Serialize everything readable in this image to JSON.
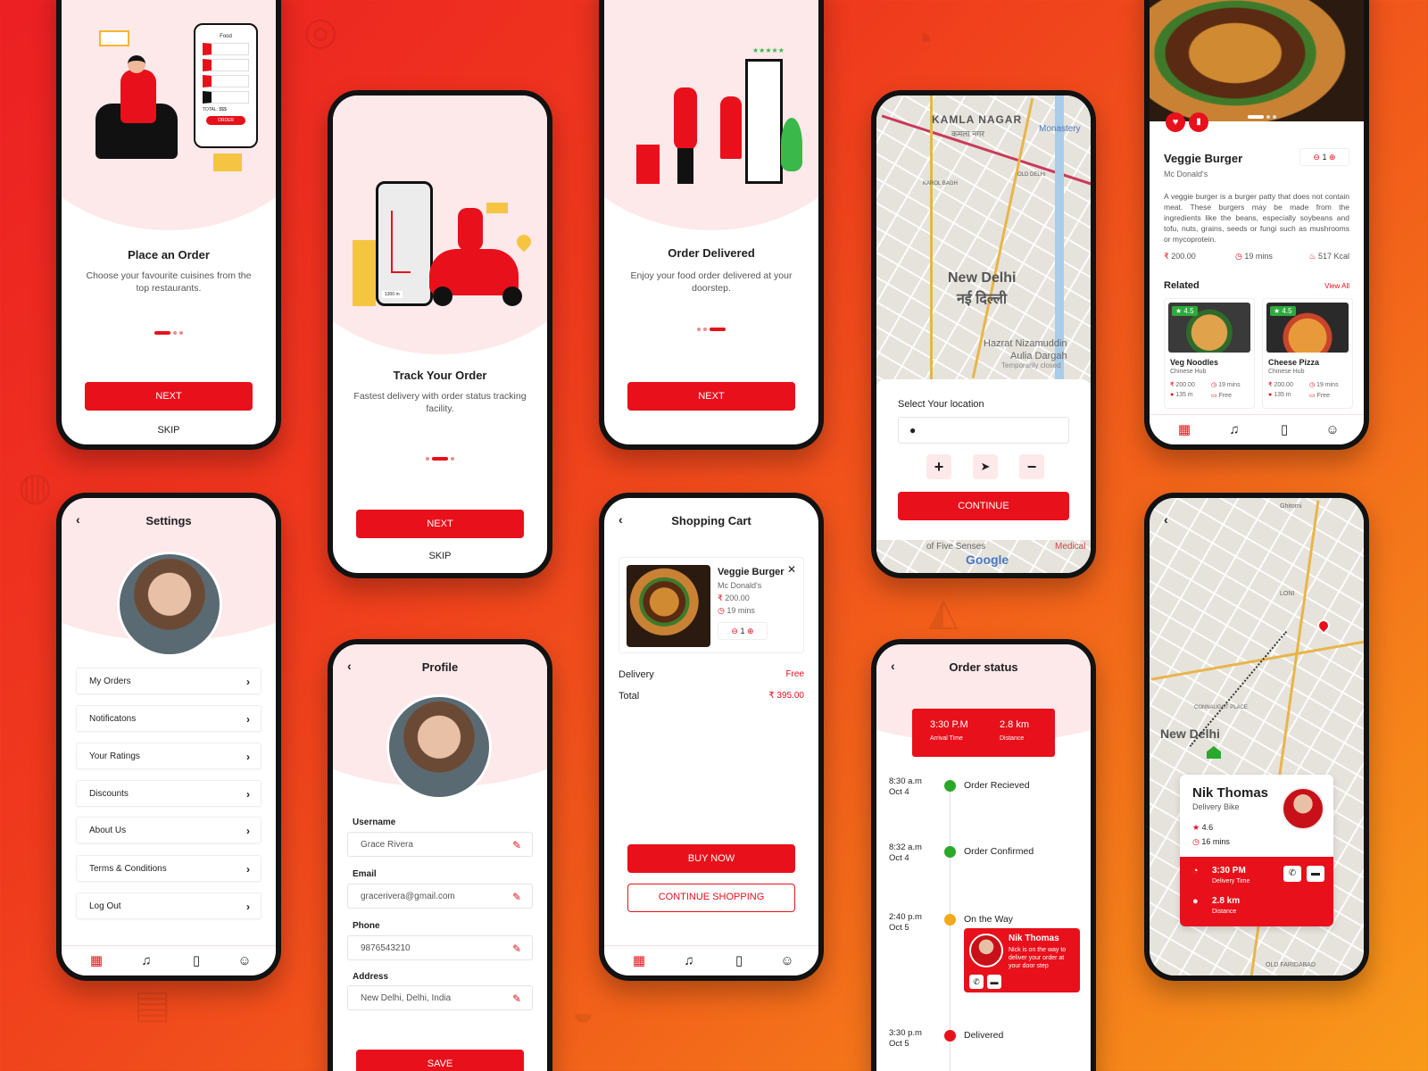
{
  "onboard1": {
    "title": "Place an Order",
    "subtitle": "Choose your favourite cuisines from the top restaurants.",
    "next": "NEXT",
    "skip": "SKIP",
    "illus_food": "Food",
    "illus_total": "TOTAL:",
    "illus_total_val": "$$$",
    "illus_order": "ORDER"
  },
  "onboard2": {
    "title": "Track Your Order",
    "subtitle": "Fastest delivery with order status tracking facility.",
    "next": "NEXT",
    "skip": "SKIP",
    "illus_dist": "1300 m"
  },
  "onboard3": {
    "title": "Order Delivered",
    "subtitle": "Enjoy your food order delivered at your doorstep.",
    "next": "NEXT"
  },
  "location": {
    "map_labels": [
      "KAMLA NAGAR",
      "कमला नगर",
      "Monastery",
      "New Delhi",
      "नई दिल्ली",
      "Hazrat Nizamuddin",
      "Aulia Dargah",
      "OLD DELHI",
      "KAROL BAGH",
      "of Five Senses",
      "Medical",
      "Temporarily closed"
    ],
    "prompt": "Select Your location",
    "continue": "CONTINUE",
    "google": "Google"
  },
  "detail": {
    "name": "Veggie Burger",
    "restaurant": "Mc Donald's",
    "qty": "1",
    "desc": "A veggie burger is a burger patty that does not contain meat. These burgers may be made from the ingredients like the beans, especially soybeans and tofu, nuts, grains, seeds or fungi such as mushrooms or mycoprotein.",
    "price": "200.00",
    "time": "19 mins",
    "kcal": "517 Kcal",
    "currency": "₹",
    "related_title": "Related",
    "view_all": "View All",
    "related": [
      {
        "rating": "4.5",
        "name": "Veg Noodles",
        "place": "Chinese Hub",
        "price": "200.00",
        "time": "19 mins",
        "dist": "135 m",
        "delivery": "Free"
      },
      {
        "rating": "4.5",
        "name": "Cheese Pizza",
        "place": "Chinese Hub",
        "price": "200.00",
        "time": "19 mins",
        "dist": "135 m",
        "delivery": "Free"
      }
    ]
  },
  "settings": {
    "title": "Settings",
    "items": [
      "My Orders",
      "Notificatons",
      "Your Ratings",
      "Discounts",
      "About Us",
      "Terms & Conditions",
      "Log Out"
    ]
  },
  "profile": {
    "title": "Profile",
    "fields": [
      {
        "label": "Username",
        "value": "Grace Rivera"
      },
      {
        "label": "Email",
        "value": "gracerivera@gmail.com"
      },
      {
        "label": "Phone",
        "value": "9876543210"
      },
      {
        "label": "Address",
        "value": "New Delhi, Delhi, India"
      }
    ],
    "save": "SAVE"
  },
  "cart": {
    "title": "Shopping Cart",
    "item": {
      "name": "Veggie Burger",
      "place": "Mc Donald's",
      "price": "200.00",
      "time": "19 mins",
      "qty": "1"
    },
    "delivery_label": "Delivery",
    "delivery_value": "Free",
    "total_label": "Total",
    "total_value": "₹ 395.00",
    "buy": "BUY NOW",
    "continue": "CONTINUE SHOPPING"
  },
  "status": {
    "title": "Order status",
    "arrival": "3:30 P.M",
    "arrival_label": "Arrival Time",
    "distance": "2.8 km",
    "distance_label": "Distance",
    "steps": [
      {
        "time": "8:30 a.m",
        "date": "Oct 4",
        "label": "Order Recieved",
        "color": "#2aa829"
      },
      {
        "time": "8:32 a.m",
        "date": "Oct 4",
        "label": "Order Confirmed",
        "color": "#2aa829"
      },
      {
        "time": "2:40 p.m",
        "date": "Oct 5",
        "label": "On the Way",
        "color": "#f2a817"
      },
      {
        "time": "3:30 p.m",
        "date": "Oct 5",
        "label": "Delivered",
        "color": "#e8101b"
      }
    ],
    "driver": {
      "name": "Nik Thomas",
      "msg": "Nick is on the way to deliver your order at your door step"
    }
  },
  "tracking": {
    "map_labels": [
      "New Delhi",
      "Ghitorni",
      "LONI",
      "CONNAUGHT PLACE",
      "OLD FARIDABAD"
    ],
    "driver": "Nik Thomas",
    "vehicle": "Delivery Bike",
    "rating": "4.6",
    "eta": "16 mins",
    "time": "3:30 PM",
    "time_label": "Delivery Time",
    "distance": "2.8 km",
    "distance_label": "Distance"
  },
  "colors": {
    "accent": "#e8101b",
    "pink": "#fde8ea",
    "green": "#2aa829",
    "amber": "#f2a817"
  }
}
